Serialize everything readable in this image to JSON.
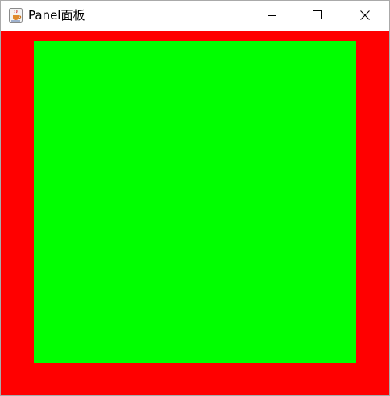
{
  "window": {
    "title": "Panel面板",
    "app_icon": "java-coffee-icon",
    "controls": {
      "minimize_icon": "minimize-icon",
      "maximize_icon": "maximize-icon",
      "close_icon": "close-icon"
    }
  },
  "panel": {
    "outer_color": "#ff0000",
    "inner_color": "#00ff00"
  }
}
